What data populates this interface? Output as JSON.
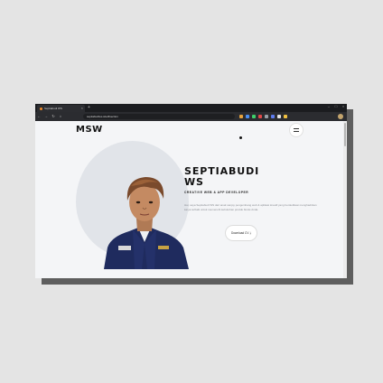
{
  "browser": {
    "tab_title": "Septiabudi WS",
    "new_tab": "+",
    "close_tab": "×",
    "url": "septiabudiws.site/#section",
    "window_controls": [
      "–",
      "□",
      "×"
    ],
    "nav": {
      "back": "←",
      "forward": "→",
      "reload": "↻",
      "home": "⌂"
    },
    "extension_colors": [
      "#e6a23c",
      "#4a8df0",
      "#3ecf6a",
      "#e04848",
      "#9aa0a6",
      "#5e7cf0",
      "#e6e6e6",
      "#f0c040"
    ]
  },
  "site": {
    "logo": "MSW",
    "hero": {
      "name": "SEPTIABUDI WS",
      "name_line1": "SEPTIABUDI",
      "name_line2": "WS",
      "role": "CREATIVE WEB & APP DEVELOPER",
      "description": "Hai, saya Septiabudi WS dari anak sanjoy pengembang web & aplikasi kreatif yang berdedikasi menghadirkan karya terbaik untuk memenuhi kebutuhan produk bisnis Anda.",
      "cta_label": "Download CV",
      "cta_icon": "download-icon"
    }
  },
  "colors": {
    "accent_text": "#111111",
    "muted_text": "#8b8e94",
    "background": "#f4f5f7"
  }
}
